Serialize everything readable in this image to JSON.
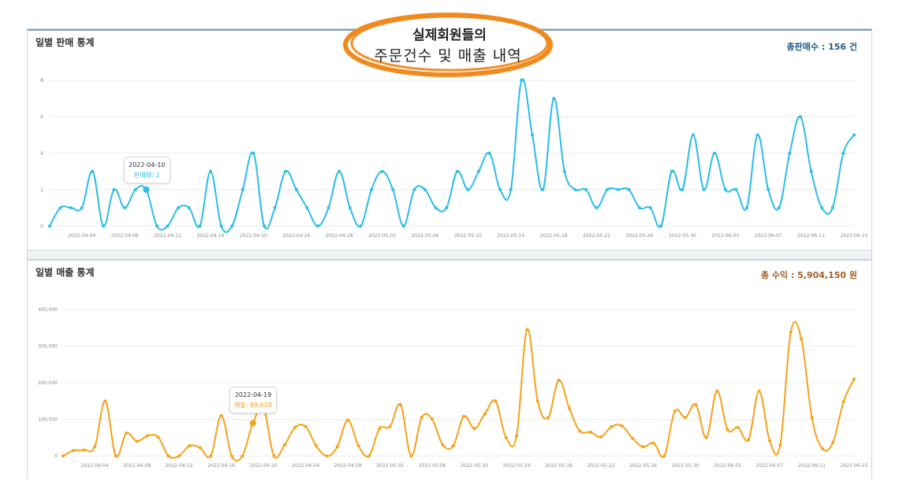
{
  "sales_panel": {
    "title": "일별 판매 통계",
    "total_label": "총판매수 :",
    "total_value": "156 건",
    "tooltip": {
      "date": "2022-04-10",
      "label": "판매량: 2"
    }
  },
  "revenue_panel": {
    "title": "일별 매출 통계",
    "total_label": "총 수익 :",
    "total_value": "5,904,150 원",
    "tooltip": {
      "date": "2022-04-19",
      "label": "매출: 89,620"
    }
  },
  "badge": {
    "line1": "실제회원들의",
    "line2": "주문건수 및 매출 내역"
  },
  "colors": {
    "sales": "#2bbde6",
    "revenue": "#f5a21b",
    "badge": "#f08a1e"
  },
  "chart_data": [
    {
      "type": "line",
      "x": [
        "2022-04-01",
        "2022-04-02",
        "2022-04-03",
        "2022-04-04",
        "2022-04-05",
        "2022-04-06",
        "2022-04-07",
        "2022-04-08",
        "2022-04-09",
        "2022-04-10",
        "2022-04-11",
        "2022-04-12",
        "2022-04-13",
        "2022-04-14",
        "2022-04-15",
        "2022-04-16",
        "2022-04-17",
        "2022-04-18",
        "2022-04-19",
        "2022-04-20",
        "2022-04-21",
        "2022-04-22",
        "2022-04-23",
        "2022-04-24",
        "2022-04-25",
        "2022-04-26",
        "2022-04-27",
        "2022-04-28",
        "2022-04-29",
        "2022-04-30",
        "2022-05-01",
        "2022-05-02",
        "2022-05-03",
        "2022-05-04",
        "2022-05-05",
        "2022-05-06",
        "2022-05-07",
        "2022-05-08",
        "2022-05-09",
        "2022-05-10",
        "2022-05-11",
        "2022-05-12",
        "2022-05-13",
        "2022-05-14",
        "2022-05-15",
        "2022-05-16",
        "2022-05-17",
        "2022-05-18",
        "2022-05-19",
        "2022-05-20",
        "2022-05-21",
        "2022-05-22",
        "2022-05-23",
        "2022-05-24",
        "2022-05-25",
        "2022-05-26",
        "2022-05-27",
        "2022-05-28",
        "2022-05-29",
        "2022-05-30",
        "2022-05-31",
        "2022-06-01",
        "2022-06-02",
        "2022-06-03",
        "2022-06-04",
        "2022-06-05",
        "2022-06-06",
        "2022-06-07",
        "2022-06-08",
        "2022-06-09",
        "2022-06-10",
        "2022-06-11",
        "2022-06-12",
        "2022-06-13",
        "2022-06-14",
        "2022-06-15"
      ],
      "values": [
        0,
        1,
        1,
        1,
        3,
        0,
        2,
        1,
        2,
        2,
        0,
        0,
        1,
        1,
        0,
        3,
        0,
        0,
        2,
        4,
        0,
        1,
        3,
        2,
        1,
        0,
        1,
        3,
        1,
        0,
        2,
        3,
        2,
        0,
        2,
        2,
        1,
        1,
        3,
        2,
        3,
        4,
        2,
        2,
        8,
        5,
        2,
        7,
        3,
        2,
        2,
        1,
        2,
        2,
        2,
        1,
        1,
        0,
        3,
        2,
        5,
        2,
        4,
        2,
        2,
        1,
        5,
        2,
        1,
        4,
        6,
        3,
        1,
        1,
        4,
        5
      ],
      "xticks": [
        "2022-04-04",
        "2022-04-08",
        "2022-04-12",
        "2022-04-16",
        "2022-04-20",
        "2022-04-24",
        "2022-04-28",
        "2022-05-02",
        "2022-05-06",
        "2022-05-10",
        "2022-05-14",
        "2022-05-18",
        "2022-05-22",
        "2022-05-26",
        "2022-05-30",
        "2022-06-03",
        "2022-06-07",
        "2022-06-11",
        "2022-06-15"
      ],
      "yticks": [
        "0",
        "2",
        "4",
        "6",
        "8"
      ],
      "ylim": [
        0,
        8
      ],
      "grid": true
    },
    {
      "type": "line",
      "x": [
        "2022-04-01",
        "2022-04-02",
        "2022-04-03",
        "2022-04-04",
        "2022-04-05",
        "2022-04-06",
        "2022-04-07",
        "2022-04-08",
        "2022-04-09",
        "2022-04-10",
        "2022-04-11",
        "2022-04-12",
        "2022-04-13",
        "2022-04-14",
        "2022-04-15",
        "2022-04-16",
        "2022-04-17",
        "2022-04-18",
        "2022-04-19",
        "2022-04-20",
        "2022-04-21",
        "2022-04-22",
        "2022-04-23",
        "2022-04-24",
        "2022-04-25",
        "2022-04-26",
        "2022-04-27",
        "2022-04-28",
        "2022-04-29",
        "2022-04-30",
        "2022-05-01",
        "2022-05-02",
        "2022-05-03",
        "2022-05-04",
        "2022-05-05",
        "2022-05-06",
        "2022-05-07",
        "2022-05-08",
        "2022-05-09",
        "2022-05-10",
        "2022-05-11",
        "2022-05-12",
        "2022-05-13",
        "2022-05-14",
        "2022-05-15",
        "2022-05-16",
        "2022-05-17",
        "2022-05-18",
        "2022-05-19",
        "2022-05-20",
        "2022-05-21",
        "2022-05-22",
        "2022-05-23",
        "2022-05-24",
        "2022-05-25",
        "2022-05-26",
        "2022-05-27",
        "2022-05-28",
        "2022-05-29",
        "2022-05-30",
        "2022-05-31",
        "2022-06-01",
        "2022-06-02",
        "2022-06-03",
        "2022-06-04",
        "2022-06-05",
        "2022-06-06",
        "2022-06-07",
        "2022-06-08",
        "2022-06-09",
        "2022-06-10",
        "2022-06-11",
        "2022-06-12",
        "2022-06-13",
        "2022-06-14",
        "2022-06-15"
      ],
      "values": [
        0,
        15000,
        16000,
        25000,
        150000,
        0,
        62000,
        40000,
        55000,
        52000,
        0,
        0,
        28000,
        22000,
        0,
        110000,
        0,
        0,
        89620,
        130000,
        0,
        30000,
        78000,
        80000,
        28000,
        0,
        25000,
        98000,
        28000,
        0,
        75000,
        80000,
        140000,
        0,
        105000,
        100000,
        30000,
        28000,
        108000,
        75000,
        115000,
        150000,
        50000,
        55000,
        345000,
        150000,
        105000,
        207000,
        130000,
        68000,
        65000,
        52000,
        80000,
        82000,
        48000,
        25000,
        35000,
        0,
        122000,
        105000,
        140000,
        50000,
        177000,
        72000,
        78000,
        45000,
        177000,
        42000,
        30000,
        338000,
        320000,
        105000,
        20000,
        37000,
        148000,
        210000
      ],
      "xticks": [
        "2022-04-04",
        "2022-04-08",
        "2022-04-12",
        "2022-04-16",
        "2022-04-20",
        "2022-04-24",
        "2022-04-28",
        "2022-05-02",
        "2022-05-06",
        "2022-05-10",
        "2022-05-14",
        "2022-05-18",
        "2022-05-22",
        "2022-05-26",
        "2022-05-30",
        "2022-06-03",
        "2022-06-07",
        "2022-06-11",
        "2022-06-15"
      ],
      "yticks": [
        "0",
        "100,000",
        "200,000",
        "300,000",
        "400,000"
      ],
      "ylim": [
        0,
        400000
      ],
      "grid": true
    }
  ]
}
